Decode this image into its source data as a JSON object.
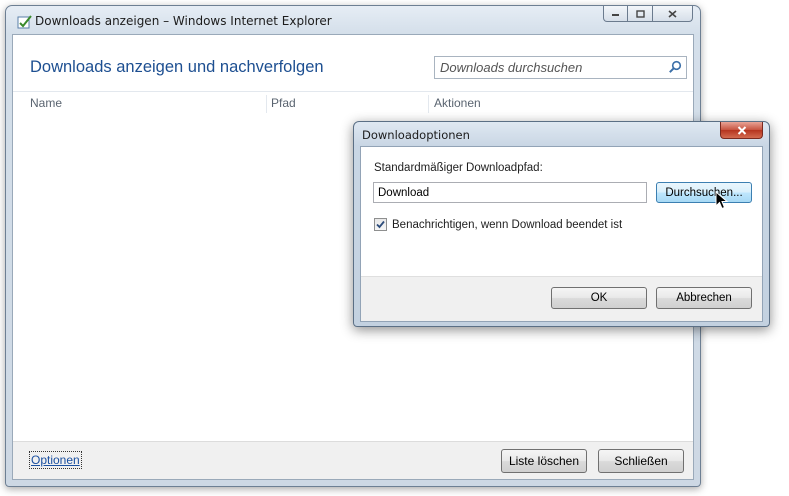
{
  "window": {
    "title": "Downloads anzeigen – Windows Internet Explorer",
    "app_icon": "download-manager-icon",
    "caption_icons": [
      "minimize-icon",
      "maximize-icon",
      "close-icon"
    ]
  },
  "main": {
    "heading": "Downloads anzeigen und nachverfolgen",
    "search": {
      "placeholder": "Downloads durchsuchen",
      "icon": "search-icon"
    },
    "columns": [
      "Name",
      "Pfad",
      "Aktionen"
    ]
  },
  "footer": {
    "options_link": "Optionen",
    "clear_list": "Liste löschen",
    "close": "Schließen"
  },
  "dialog": {
    "title": "Downloadoptionen",
    "path_label": "Standardmäßiger Downloadpfad:",
    "path_value": "Download",
    "browse": "Durchsuchen...",
    "notify_label": "Benachrichtigen, wenn Download beendet ist",
    "notify_checked": true,
    "ok": "OK",
    "cancel": "Abbrechen"
  },
  "colors": {
    "heading": "#1d4f91",
    "link": "#1a4fa0",
    "close_button": "#c7523e"
  }
}
